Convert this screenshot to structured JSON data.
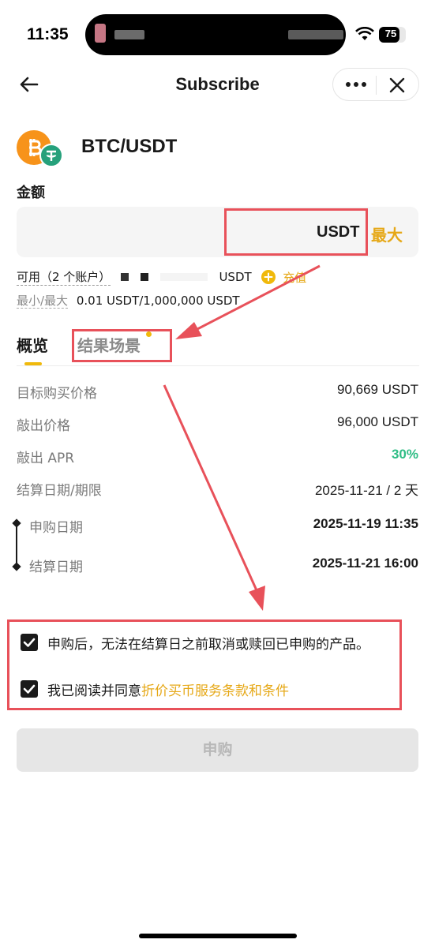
{
  "status": {
    "time": "11:35",
    "battery": "75",
    "battery_level": 0.75
  },
  "nav": {
    "title": "Subscribe"
  },
  "pair": {
    "name": "BTC/USDT"
  },
  "amount": {
    "label": "金额",
    "unit": "USDT",
    "max_label": "最大",
    "value": ""
  },
  "balance": {
    "label": "可用（2 个账户）",
    "unit": "USDT",
    "recharge": "充值"
  },
  "limits": {
    "label": "最小/最大",
    "value": "0.01 USDT/1,000,000 USDT"
  },
  "tabs": [
    {
      "label": "概览",
      "active": true
    },
    {
      "label": "结果场景",
      "active": false
    }
  ],
  "details": [
    {
      "label": "目标购买价格",
      "value": "90,669 USDT"
    },
    {
      "label": "敲出价格",
      "value": "96,000 USDT"
    },
    {
      "label": "敲出 APR",
      "value": "30%"
    },
    {
      "label": "结算日期/期限",
      "value": "2025-11-21 / 2 天"
    }
  ],
  "timeline": [
    {
      "label": "申购日期",
      "value": "2025-11-19 11:35"
    },
    {
      "label": "结算日期",
      "value": "2025-11-21 16:00"
    }
  ],
  "agreements": {
    "notice": "申购后，无法在结算日之前取消或赎回已申购的产品。",
    "consent_prefix": "我已阅读并同意",
    "consent_link": "折价买币服务条款和条件"
  },
  "submit": {
    "label": "申购"
  },
  "colors": {
    "accent": "#f0b90b",
    "link": "#e6a817",
    "green": "#2ebd85",
    "annotation": "#e8515a"
  }
}
